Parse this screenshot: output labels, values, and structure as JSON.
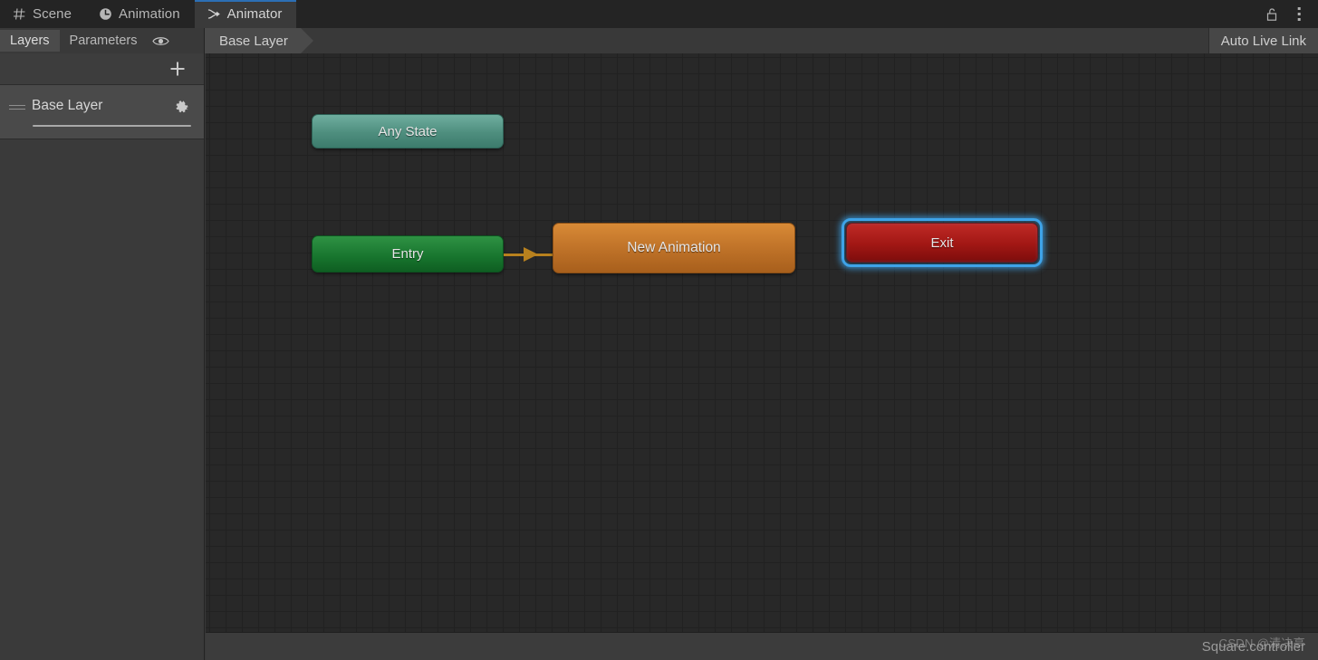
{
  "window": {
    "tabs": [
      {
        "label": "Scene",
        "icon": "grid-icon",
        "active": false
      },
      {
        "label": "Animation",
        "icon": "clock-icon",
        "active": false
      },
      {
        "label": "Animator",
        "icon": "branch-arrow-icon",
        "active": true
      }
    ],
    "lock_icon": "unlocked-padlock-icon",
    "menu_icon": "kebab-menu-icon"
  },
  "subbar": {
    "left_tabs": [
      {
        "label": "Layers",
        "active": true
      },
      {
        "label": "Parameters",
        "active": false
      }
    ],
    "eye_icon": "eye-icon",
    "breadcrumb": "Base Layer",
    "auto_live_link": "Auto Live Link"
  },
  "left_panel": {
    "add_label": "+",
    "layers": [
      {
        "name": "Base Layer",
        "settings_icon": "gear-icon",
        "drag_icon": "drag-handle-icon"
      }
    ]
  },
  "graph": {
    "nodes": [
      {
        "id": "any-state",
        "label": "Any State",
        "type": "any-state",
        "color": "#4e8e7e",
        "selected": false
      },
      {
        "id": "entry",
        "label": "Entry",
        "type": "entry",
        "color": "#17742d",
        "selected": false
      },
      {
        "id": "new-animation",
        "label": "New Animation",
        "type": "state-default",
        "color": "#c2752a",
        "selected": false
      },
      {
        "id": "exit",
        "label": "Exit",
        "type": "exit",
        "color": "#a11714",
        "selected": true
      }
    ],
    "transitions": [
      {
        "from": "entry",
        "to": "new-animation",
        "color": "#b8811e"
      }
    ],
    "selection_color": "#3ea3e8"
  },
  "status": {
    "controller_name": "Square.controller"
  },
  "watermark": {
    "text": "CSDN @清决亭"
  }
}
